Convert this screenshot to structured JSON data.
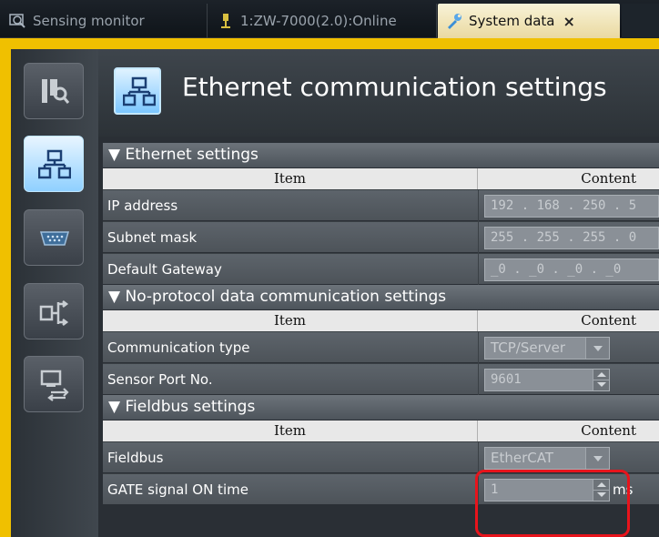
{
  "tabs": [
    {
      "label": "Sensing monitor",
      "icon": "magnifier-monitor-icon"
    },
    {
      "label": "1:ZW-7000(2.0):Online",
      "icon": "sensor-device-icon"
    },
    {
      "label": "System data",
      "icon": "wrench-icon",
      "close": "×"
    }
  ],
  "sidebar": {
    "items": [
      {
        "icon": "sensor-search-icon",
        "active": false
      },
      {
        "icon": "ethernet-network-icon",
        "active": true
      },
      {
        "icon": "serial-port-icon",
        "active": false
      },
      {
        "icon": "io-arrow-icon",
        "active": false
      },
      {
        "icon": "display-transfer-icon",
        "active": false
      }
    ]
  },
  "page": {
    "title": "Ethernet communication settings",
    "icon": "ethernet-network-icon"
  },
  "columns": {
    "item": "Item",
    "content": "Content"
  },
  "sections": {
    "ethernet": {
      "title": "▼ Ethernet settings",
      "rows": [
        {
          "label": "IP address",
          "value": "192 . 168 . 250 . 5"
        },
        {
          "label": "Subnet mask",
          "value": "255 . 255 . 255 . 0"
        },
        {
          "label": "Default Gateway",
          "value": "_0 . _0 . _0 . _0"
        }
      ]
    },
    "noprotocol": {
      "title": "▼ No-protocol data communication settings",
      "rows": [
        {
          "label": "Communication type",
          "value": "TCP/Server"
        },
        {
          "label": "Sensor Port No.",
          "value": "9601"
        }
      ]
    },
    "fieldbus": {
      "title": "▼ Fieldbus settings",
      "rows": [
        {
          "label": "Fieldbus",
          "value": "EtherCAT"
        },
        {
          "label": "GATE signal ON time",
          "value": "1",
          "unit": "ms"
        }
      ]
    }
  },
  "colors": {
    "frame": "#f0c000",
    "highlight": "#e8141c",
    "active_tab": "#f8f3d8"
  }
}
